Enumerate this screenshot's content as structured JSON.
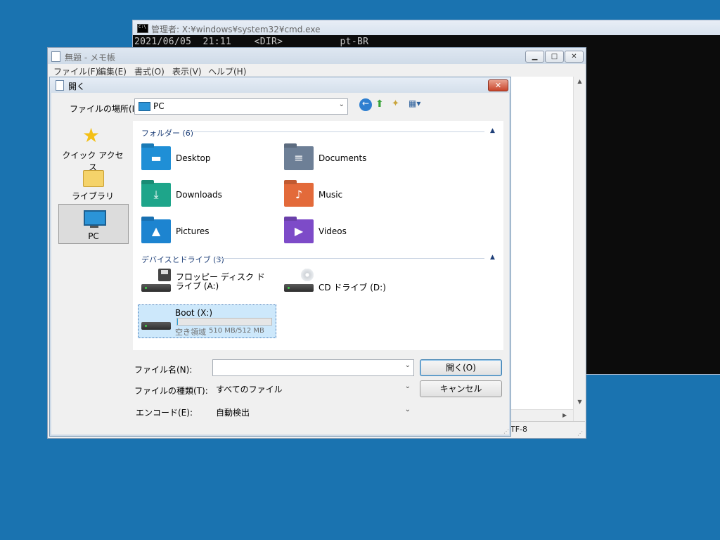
{
  "cmd": {
    "title": "管理者: X:¥windows¥system32¥cmd.exe",
    "console_line": "2021/06/05  21:11    <DIR>          pt-BR"
  },
  "notepad": {
    "title": "無題 - メモ帳",
    "menu": [
      "ファイル(F)",
      "編集(E)",
      "書式(O)",
      "表示(V)",
      "ヘルプ(H)"
    ],
    "status_encoding": "TF-8",
    "window_buttons": [
      "minimize-icon",
      "maximize-icon",
      "close-icon"
    ]
  },
  "dialog": {
    "title": "開く",
    "location_label": "ファイルの場所(I):",
    "location_value": "PC",
    "places": [
      {
        "label": "クイック アクセス",
        "icon": "star-icon"
      },
      {
        "label": "ライブラリ",
        "icon": "library-folder-icon"
      },
      {
        "label": "PC",
        "icon": "computer-icon",
        "selected": true
      }
    ],
    "folders_header": "フォルダー (6)",
    "folders": [
      {
        "name": "Desktop",
        "icon": "desktop-folder-icon",
        "color": "#1f8fd6"
      },
      {
        "name": "Documents",
        "icon": "documents-folder-icon",
        "color": "#6d7f96"
      },
      {
        "name": "Downloads",
        "icon": "downloads-folder-icon",
        "color": "#1ea58a"
      },
      {
        "name": "Music",
        "icon": "music-folder-icon",
        "color": "#e36a3a"
      },
      {
        "name": "Pictures",
        "icon": "pictures-folder-icon",
        "color": "#1d84d0"
      },
      {
        "name": "Videos",
        "icon": "videos-folder-icon",
        "color": "#7d4bc8"
      }
    ],
    "devices_header": "デバイスとドライブ (3)",
    "devices": [
      {
        "name": "フロッピー ディスク ドライブ (A:)",
        "icon": "floppy-drive-icon"
      },
      {
        "name": "CD ドライブ (D:)",
        "icon": "cd-drive-icon"
      },
      {
        "name": "Boot (X:)",
        "icon": "hard-drive-icon",
        "free_label": "空き領域",
        "capacity": "510 MB/512 MB",
        "used_fraction": 0.004
      }
    ],
    "filename_label": "ファイル名(N):",
    "filename_value": "",
    "filetype_label": "ファイルの種類(T):",
    "filetype_value": "すべてのファイル",
    "encoding_label": "エンコード(E):",
    "encoding_value": "自動検出",
    "open_button": "開く(O)",
    "cancel_button": "キャンセル"
  },
  "colors": {
    "desktop": "#1a73b0",
    "selection": "#cde8fb",
    "header_text": "#1e3f78"
  }
}
